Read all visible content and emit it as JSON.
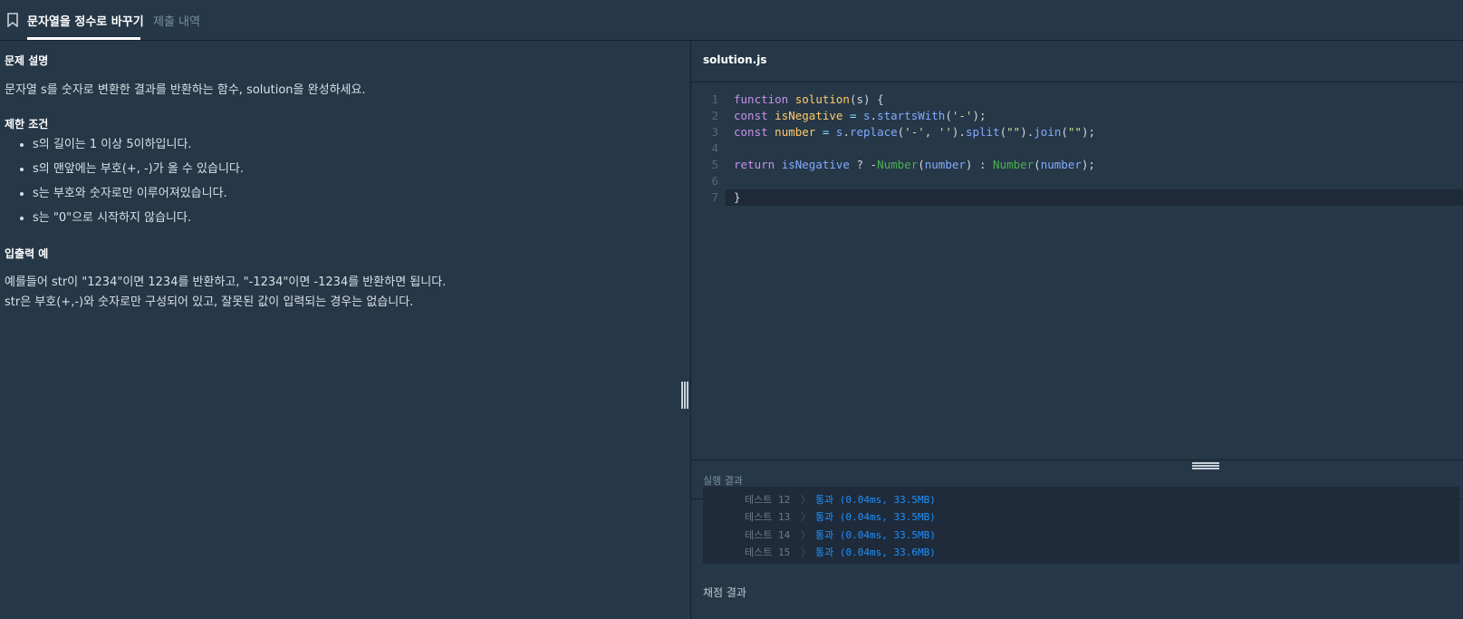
{
  "tabs": {
    "active": "문자열을 정수로 바꾸기",
    "inactive": "제출 내역"
  },
  "problem": {
    "heading_desc": "문제 설명",
    "desc": "문자열 s를 숫자로 변환한 결과를 반환하는 함수, solution을 완성하세요.",
    "heading_constraints": "제한 조건",
    "constraints": [
      "s의 길이는 1 이상 5이하입니다.",
      "s의 맨앞에는 부호(+, -)가 올 수 있습니다.",
      "s는 부호와 숫자로만 이루어져있습니다.",
      "s는 \"0\"으로 시작하지 않습니다."
    ],
    "heading_examples": "입출력 예",
    "example_lines": [
      "예를들어 str이 \"1234\"이면 1234를 반환하고, \"-1234\"이면 -1234를 반환하면 됩니다.",
      "str은 부호(+,-)와 숫자로만 구성되어 있고, 잘못된 값이 입력되는 경우는 없습니다."
    ]
  },
  "editor": {
    "filename": "solution.js",
    "line_numbers": [
      "1",
      "2",
      "3",
      "4",
      "5",
      "6",
      "7"
    ],
    "code": {
      "l1": [
        "function",
        "solution",
        "(s) {"
      ],
      "l2": [
        "const",
        "isNegative",
        " = ",
        "s",
        ".",
        "startsWith",
        "(",
        "'-'",
        ");"
      ],
      "l3": [
        "const",
        "number",
        " = ",
        "s",
        ".",
        "replace",
        "(",
        "'-'",
        ", ",
        "''",
        ").",
        "split",
        "(",
        "\"\"",
        ").",
        "join",
        "(",
        "\"\"",
        ");"
      ],
      "l5": [
        "return",
        "isNegative",
        " ? -",
        "Number",
        "(",
        "number",
        ") : ",
        "Number",
        "(",
        "number",
        ");"
      ],
      "l7": [
        "}"
      ]
    }
  },
  "results": {
    "title": "실행 결과",
    "tests": [
      {
        "label": "테스트 12",
        "chevron": "〉",
        "result": "통과 (0.04ms, 33.5MB)"
      },
      {
        "label": "테스트 13",
        "chevron": "〉",
        "result": "통과 (0.04ms, 33.5MB)"
      },
      {
        "label": "테스트 14",
        "chevron": "〉",
        "result": "통과 (0.04ms, 33.5MB)"
      },
      {
        "label": "테스트 15",
        "chevron": "〉",
        "result": "통과 (0.04ms, 33.6MB)"
      }
    ],
    "grade_title": "채점 결과"
  },
  "colors": {
    "background": "#263747",
    "accent_pass": "#1e90ff",
    "keyword": "#c792ea",
    "function_name": "#ffcb6b",
    "string": "#c3e88d",
    "builtin": "#4caf50"
  },
  "icons": {
    "bookmark": "bookmark-icon",
    "splitter_v": "vertical-drag-handle-icon",
    "splitter_h": "horizontal-drag-handle-icon"
  }
}
